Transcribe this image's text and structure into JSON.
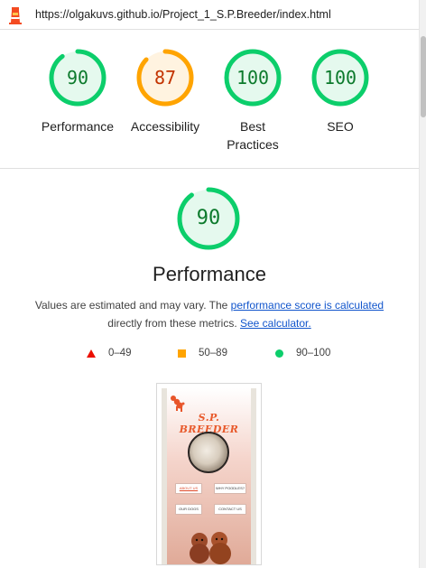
{
  "browser": {
    "url": "https://olgakuvs.github.io/Project_1_S.P.Breeder/index.html",
    "logo_icon": "lighthouse-icon"
  },
  "scores": [
    {
      "label": "Performance",
      "score": "90",
      "value": 90,
      "status": "pass"
    },
    {
      "label": "Accessibility",
      "score": "87",
      "value": 87,
      "status": "average"
    },
    {
      "label": "Best Practices",
      "score": "100",
      "value": 100,
      "status": "pass"
    },
    {
      "label": "SEO",
      "score": "100",
      "value": 100,
      "status": "pass"
    }
  ],
  "colors": {
    "pass_ring": "#0cce6b",
    "pass_fill": "#e5f9ee",
    "pass_text": "#0c7a2c",
    "average_ring": "#ffa400",
    "average_fill": "#fff3e0",
    "average_text": "#c33300",
    "fail": "#eb0f00",
    "link": "#1155cc"
  },
  "performance": {
    "score": "90",
    "value": 90,
    "title": "Performance",
    "desc_prefix": "Values are estimated and may vary. The ",
    "desc_link": "performance score is calculated",
    "desc_middle": " directly from these metrics. ",
    "calc_link": "See calculator."
  },
  "legend": [
    {
      "range": "0–49",
      "shape": "triangle"
    },
    {
      "range": "50–89",
      "shape": "square"
    },
    {
      "range": "90–100",
      "shape": "circle"
    }
  ],
  "thumbnail": {
    "brand": "S.P. BREEDER",
    "buttons": [
      "ABOUT US",
      "WHY POODLES?",
      "OUR DOGS",
      "CONTACT US"
    ]
  }
}
